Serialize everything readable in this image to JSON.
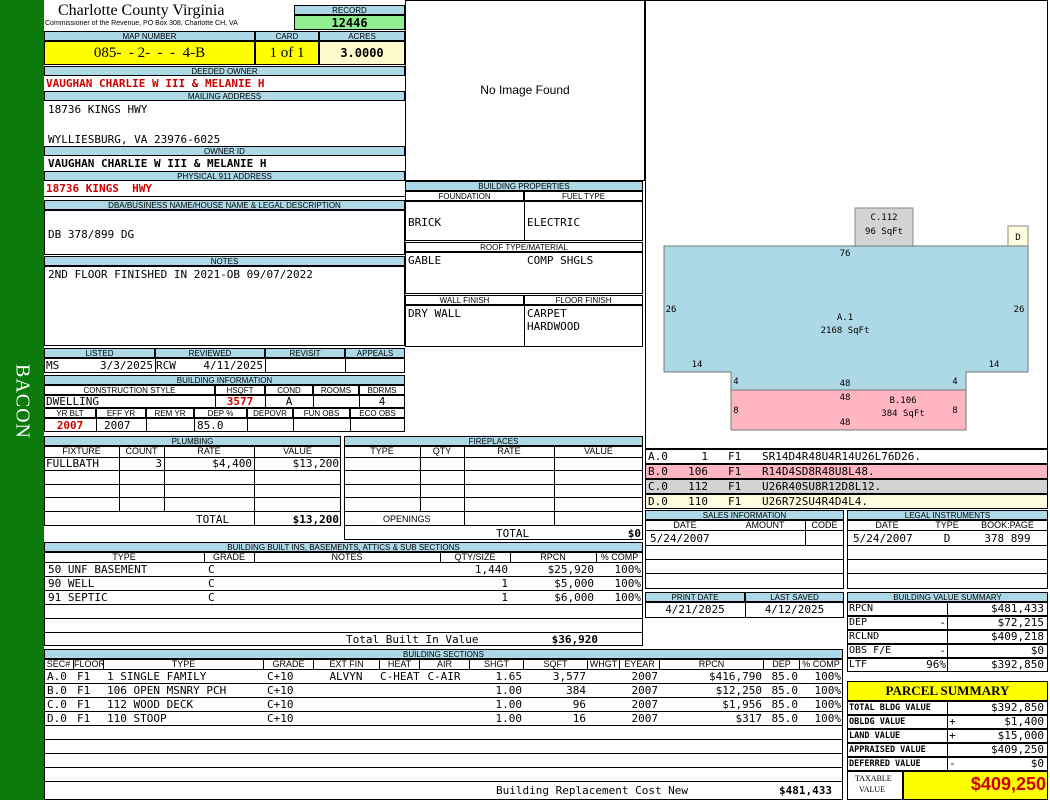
{
  "side": {
    "label": "BACON"
  },
  "header": {
    "county": "Charlotte County Virginia",
    "office": "Commissioner of the Revenue, PO Box 308, Charlotte CH, VA",
    "record_label": "RECORD",
    "record": "12446"
  },
  "parcel": {
    "map_label": "MAP NUMBER",
    "map": "085-  - 2-  -  -  4-B",
    "card_label": "CARD",
    "card": "1 of 1",
    "acres_label": "ACRES",
    "acres": "3.0000"
  },
  "owner": {
    "deeded_label": "DEEDED OWNER",
    "deeded": "VAUGHAN CHARLIE W III & MELANIE H",
    "mailing_label": "MAILING ADDRESS",
    "mail1": "18736 KINGS HWY",
    "mail2": "WYLLIESBURG, VA 23976-6025",
    "id_label": "OWNER ID",
    "id": "VAUGHAN CHARLIE W III & MELANIE H",
    "phys_label": "PHYSICAL 911 ADDRESS",
    "phys": "18736 KINGS  HWY",
    "dba_label": "DBA/BUSINESS NAME/HOUSE NAME & LEGAL DESCRIPTION",
    "dba": "DB 378/899 DG",
    "notes_label": "NOTES",
    "notes": "2ND FLOOR FINISHED IN 2021-OB 09/07/2022"
  },
  "image": {
    "text": "No Image Found"
  },
  "building_props": {
    "title": "BUILDING PROPERTIES",
    "foundation_label": "FOUNDATION",
    "fuel_label": "FUEL TYPE",
    "foundation": "BRICK",
    "fuel": "ELECTRIC",
    "roof_label": "ROOF TYPE/MATERIAL",
    "roof1": "GABLE",
    "roof2": "COMP SHGLS",
    "wall_label": "WALL FINISH",
    "floor_label": "FLOOR FINISH",
    "wall": "DRY WALL",
    "floor1": "CARPET",
    "floor2": "HARDWOOD"
  },
  "review": {
    "listed_label": "LISTED",
    "reviewed_label": "REVIEWED",
    "revisit_label": "REVISIT",
    "appeals_label": "APPEALS",
    "listed_by": "MS",
    "listed_date": "3/3/2025",
    "reviewed_by": "RCW",
    "reviewed_date": "4/11/2025"
  },
  "bldg_info": {
    "title": "BUILDING INFORMATION",
    "h": [
      "CONSTRUCTION STYLE",
      "HSQFT",
      "COND",
      "ROOMS",
      "BDRMS"
    ],
    "style": "DWELLING",
    "hsqft": "3577",
    "cond": "A",
    "rooms": "",
    "bdrms": "4",
    "h2": [
      "YR BLT",
      "EFF YR",
      "REM YR",
      "DEP %",
      "DEPOVR",
      "FUN OBS",
      "ECO OBS"
    ],
    "yrblt": "2007",
    "effyr": "2007",
    "remyr": "",
    "dep": "85.0"
  },
  "plumbing": {
    "title": "PLUMBING",
    "h": [
      "FIXTURE",
      "COUNT",
      "RATE",
      "VALUE"
    ],
    "rows": [
      [
        "FULLBATH",
        "3",
        "$4,400",
        "$13,200"
      ]
    ],
    "total_label": "TOTAL",
    "total": "$13,200"
  },
  "fireplaces": {
    "title": "FIREPLACES",
    "h": [
      "TYPE",
      "QTY",
      "RATE",
      "VALUE"
    ],
    "openings_label": "OPENINGS",
    "total_label": "TOTAL",
    "total": "$0"
  },
  "builtins": {
    "title": "BUILDING BUILT INS, BASEMENTS, ATTICS & SUB SECTIONS",
    "h": [
      "TYPE",
      "GRADE",
      "NOTES",
      "QTY/SIZE",
      "RPCN",
      "% COMP"
    ],
    "rows": [
      [
        "50 UNF BASEMENT",
        "C",
        "",
        "1,440",
        "$25,920",
        "100%"
      ],
      [
        "90 WELL",
        "C",
        "",
        "1",
        "$5,000",
        "100%"
      ],
      [
        "91 SEPTIC",
        "C",
        "",
        "1",
        "$6,000",
        "100%"
      ]
    ],
    "total_label": "Total Built In Value",
    "total": "$36,920"
  },
  "sections": {
    "title": "BUILDING SECTIONS",
    "h": [
      "SEC#",
      "FLOOR",
      "TYPE",
      "GRADE",
      "EXT FIN",
      "HEAT",
      "AIR",
      "SHGT",
      "SQFT",
      "WHGT",
      "EYEAR",
      "RPCN",
      "DEP",
      "% COMP"
    ],
    "rows": [
      [
        "A.0",
        "F1",
        "1 SINGLE FAMILY",
        "C+10",
        "ALVYN",
        "C-HEAT",
        "C-AIR",
        "1.65",
        "3,577",
        "",
        "2007",
        "$416,790",
        "85.0",
        "100%"
      ],
      [
        "B.0",
        "F1",
        "106 OPEN MSNRY PCH",
        "C+10",
        "",
        "",
        "",
        "1.00",
        "384",
        "",
        "2007",
        "$12,250",
        "85.0",
        "100%"
      ],
      [
        "C.0",
        "F1",
        "112 WOOD DECK",
        "C+10",
        "",
        "",
        "",
        "1.00",
        "96",
        "",
        "2007",
        "$1,956",
        "85.0",
        "100%"
      ],
      [
        "D.0",
        "F1",
        "110 STOOP",
        "C+10",
        "",
        "",
        "",
        "1.00",
        "16",
        "",
        "2007",
        "$317",
        "85.0",
        "100%"
      ]
    ],
    "total_label": "Building Replacement Cost New",
    "total": "$481,433"
  },
  "sketch": {
    "c_label": "C.112",
    "c_area": "96 SqFt",
    "d_label": "D",
    "a_label": "A.1",
    "a_area": "2168 SqFt",
    "b_label": "B.106",
    "b_area": "384 SqFt",
    "dims": {
      "top": "76",
      "left": "26",
      "right": "26",
      "bl": "14",
      "br": "14",
      "n1": "4",
      "n2": "4",
      "b_top": "48",
      "b_mid": "48",
      "b_bot": "48",
      "b_l": "8",
      "b_r": "8"
    },
    "colors": {
      "a": "#add8e6",
      "b": "#ffb6c1",
      "c": "#d3d3d3",
      "d": "#ffffe0"
    },
    "legend": [
      {
        "code": "A.0",
        "n": "1",
        "f": "F1",
        "desc": "SR14D4R48U4R14U26L76D26.",
        "color": "#ffffff"
      },
      {
        "code": "B.0",
        "n": "106",
        "f": "F1",
        "desc": "R14D4SD8R48U8L48.",
        "color": "#ffb6c1"
      },
      {
        "code": "C.0",
        "n": "112",
        "f": "F1",
        "desc": "U26R40SU8R12D8L12.",
        "color": "#d3d3d3"
      },
      {
        "code": "D.0",
        "n": "110",
        "f": "F1",
        "desc": "U26R72SU4R4D4L4.",
        "color": "#ffffe0"
      }
    ]
  },
  "sales": {
    "title": "SALES INFORMATION",
    "h": [
      "DATE",
      "AMOUNT",
      "CODE"
    ],
    "date": "5/24/2007"
  },
  "legal": {
    "title": "LEGAL INSTRUMENTS",
    "h": [
      "DATE",
      "TYPE",
      "BOOK:PAGE"
    ],
    "date": "5/24/2007",
    "type": "D",
    "book": "378 899"
  },
  "print": {
    "print_label": "PRINT DATE",
    "saved_label": "LAST SAVED",
    "print": "4/21/2025",
    "saved": "4/12/2025"
  },
  "value_summary": {
    "title": "BUILDING VALUE SUMMARY",
    "rows": [
      {
        "label": "RPCN",
        "sign": "",
        "value": "$481,433"
      },
      {
        "label": "DEP",
        "sign": "-",
        "value": "$72,215"
      },
      {
        "label": "RCLND",
        "sign": "",
        "value": "$409,218"
      },
      {
        "label": "OBS F/E",
        "sign": "-",
        "value": "$0"
      },
      {
        "label": "LTF",
        "sign": "96%",
        "value": "$392,850"
      }
    ]
  },
  "parcel_summary": {
    "title": "PARCEL SUMMARY",
    "rows": [
      {
        "label": "TOTAL BLDG VALUE",
        "sign": "",
        "value": "$392,850"
      },
      {
        "label": "OBLDG VALUE",
        "sign": "+",
        "value": "$1,400"
      },
      {
        "label": "LAND VALUE",
        "sign": "+",
        "value": "$15,000"
      },
      {
        "label": "APPRAISED VALUE",
        "sign": "",
        "value": "$409,250"
      },
      {
        "label": "DEFERRED VALUE",
        "sign": "-",
        "value": "$0"
      }
    ],
    "taxable_label1": "TAXABLE",
    "taxable_label2": "VALUE",
    "taxable": "$409,250"
  }
}
